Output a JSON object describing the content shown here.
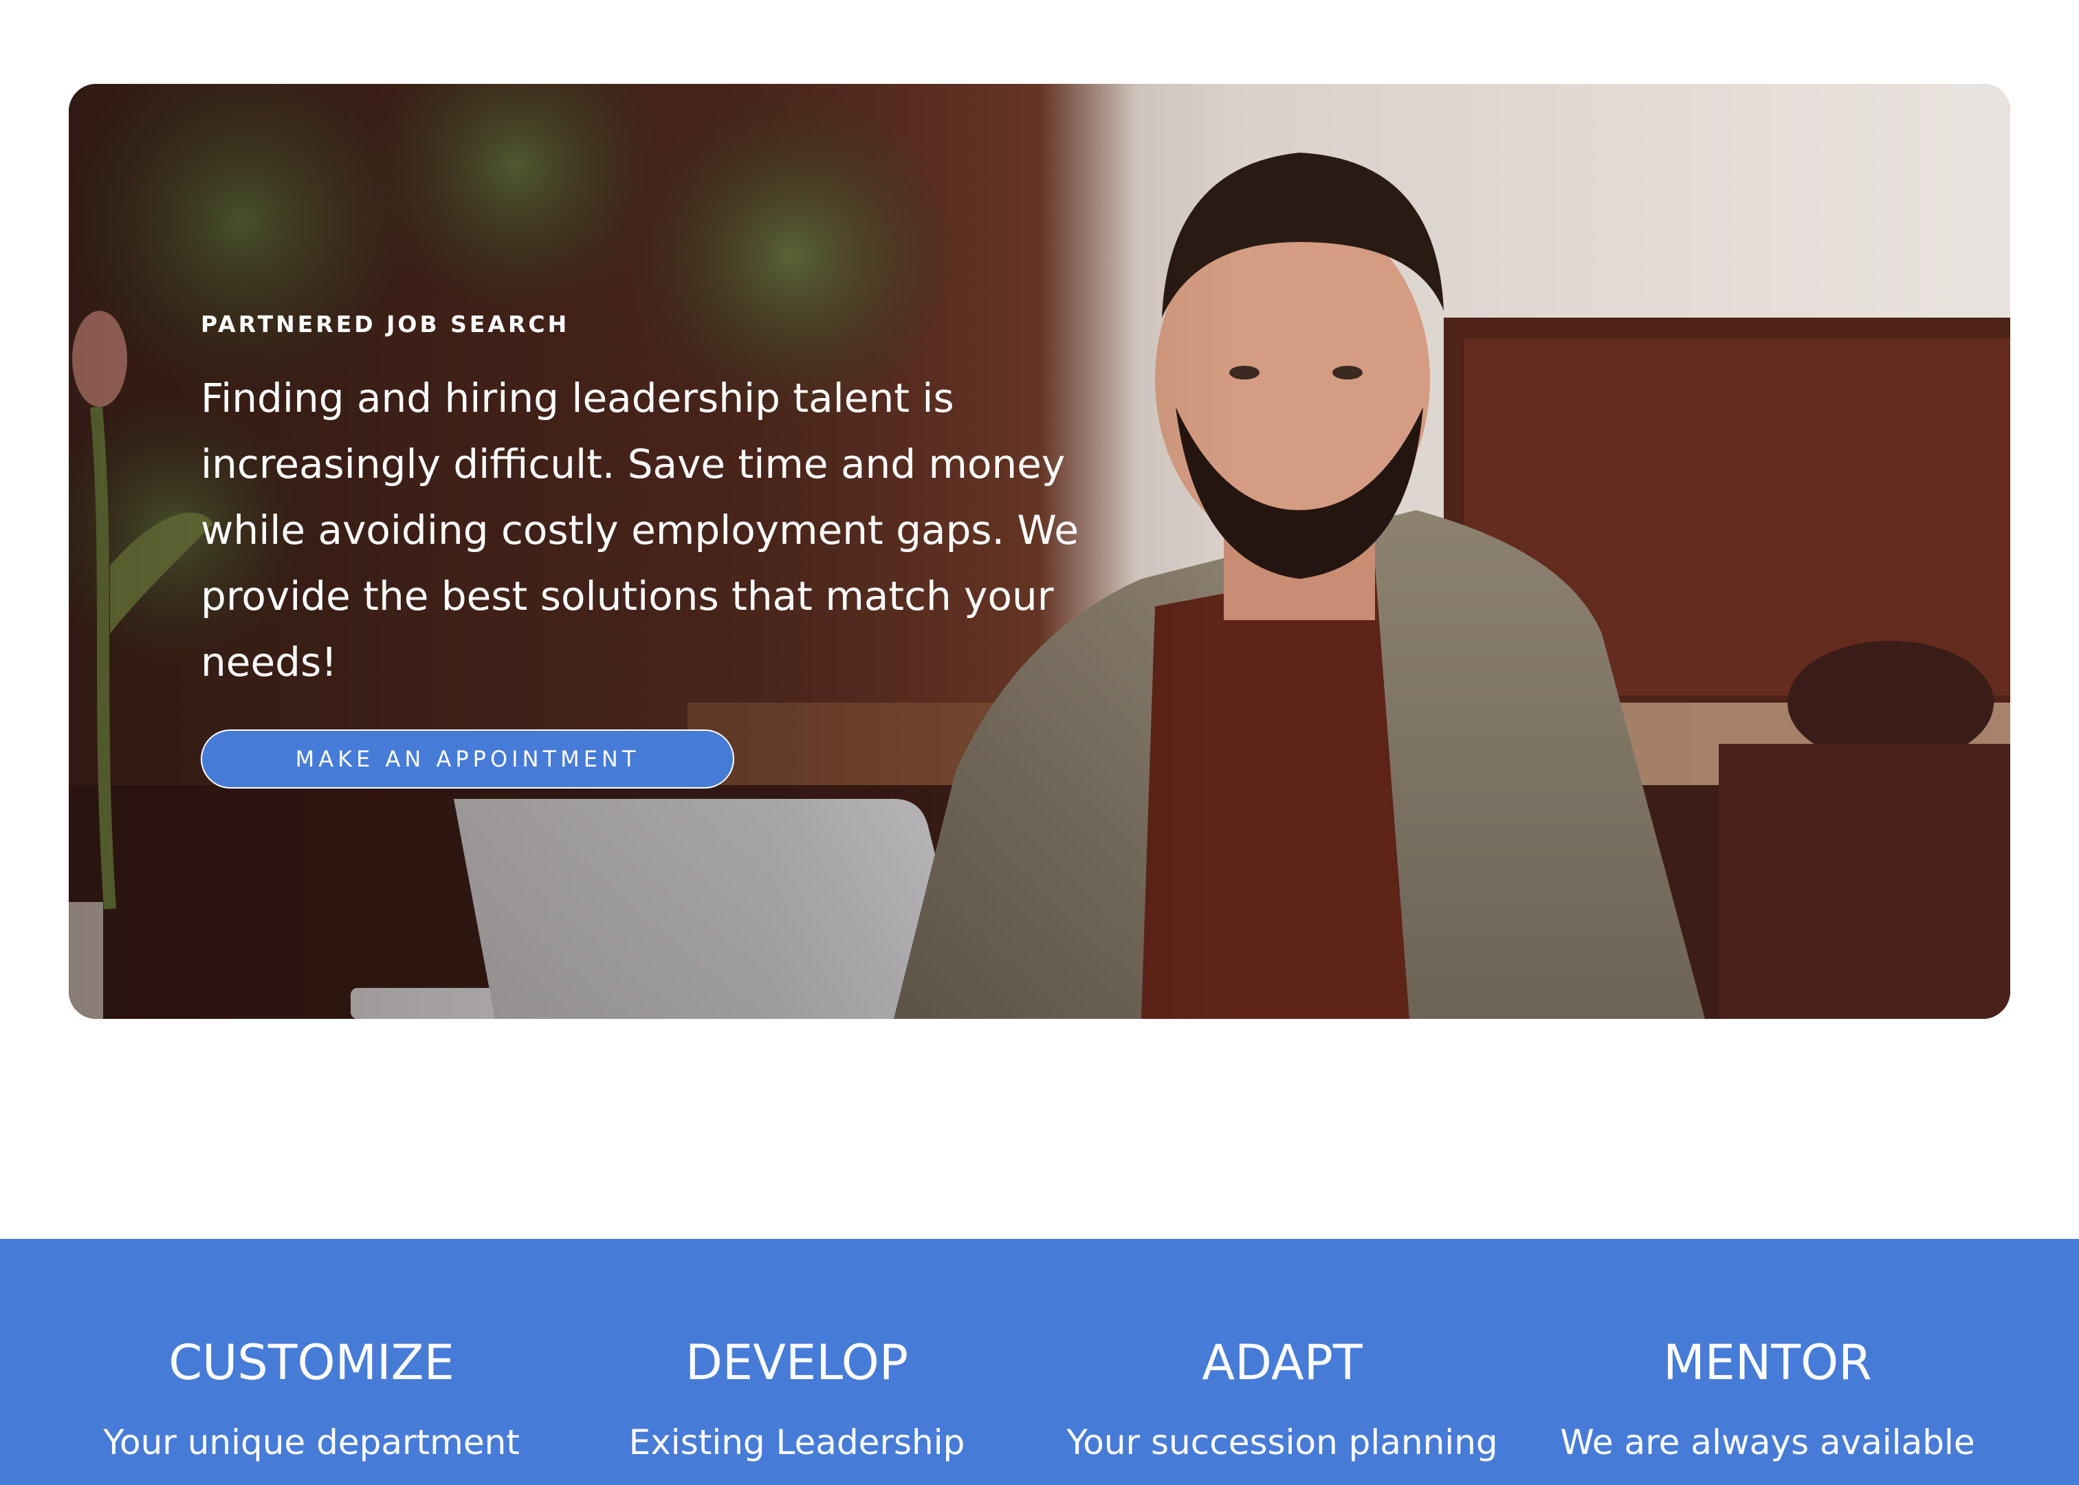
{
  "hero": {
    "eyebrow": "PARTNERED JOB SEARCH",
    "text": "Finding and hiring leadership talent is increasingly difficult. Save time and money while avoiding costly employment gaps. We provide the best solutions that match your needs!",
    "cta_label": "MAKE AN APPOINTMENT",
    "image": "photo-of-bearded-man-at-laptop-in-cafe"
  },
  "features": [
    {
      "title": "CUSTOMIZE",
      "subtitle": "Your unique department"
    },
    {
      "title": "DEVELOP",
      "subtitle": "Existing Leadership"
    },
    {
      "title": "ADAPT",
      "subtitle": "Your succession planning"
    },
    {
      "title": "MENTOR",
      "subtitle": "We are always available"
    }
  ],
  "colors": {
    "accent": "#477bd8",
    "background": "#ffffff",
    "text_on_accent": "#ffffff"
  }
}
